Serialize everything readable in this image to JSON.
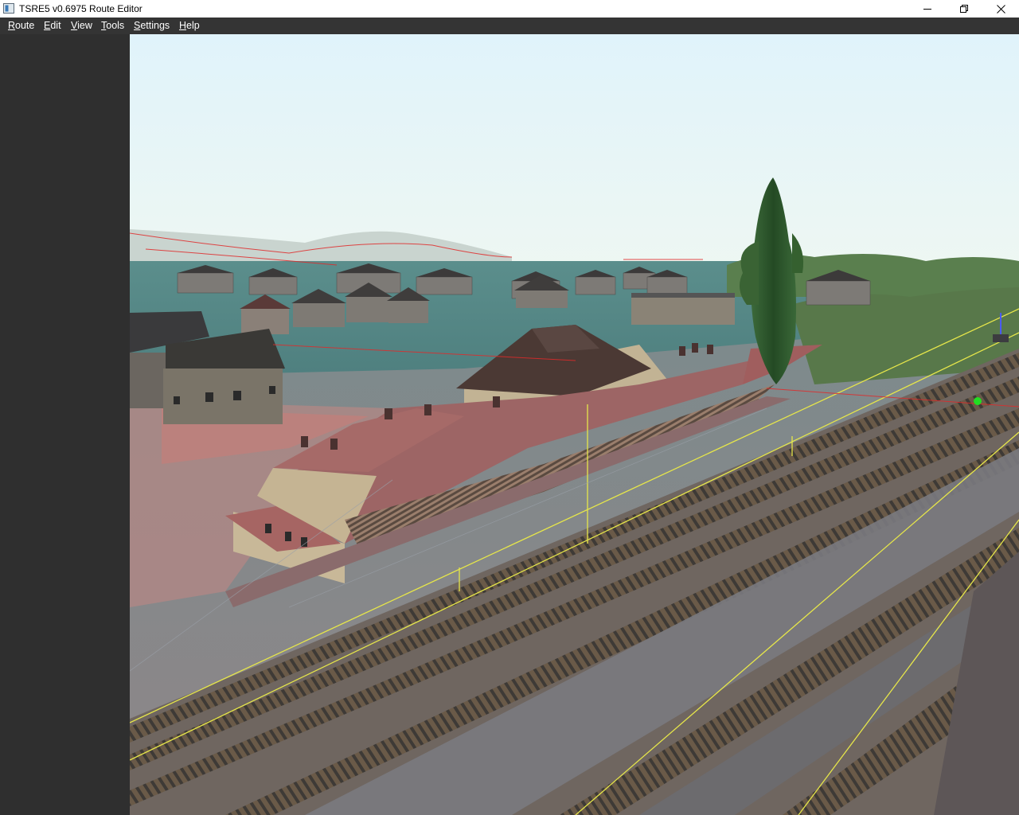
{
  "window": {
    "title": "TSRE5 v0.6975 Route Editor",
    "controls": [
      "minimize-icon",
      "restore-icon",
      "close-icon"
    ]
  },
  "menu": {
    "items": [
      {
        "label_first": "R",
        "label_rest": "oute"
      },
      {
        "label_first": "E",
        "label_rest": "dit"
      },
      {
        "label_first": "V",
        "label_rest": "iew"
      },
      {
        "label_first": "T",
        "label_rest": "ools"
      },
      {
        "label_first": "S",
        "label_rest": "ettings"
      },
      {
        "label_first": "H",
        "label_rest": "elp"
      }
    ]
  },
  "colors": {
    "titlebar_bg": "#ffffff",
    "menubar_bg": "#343434",
    "menu_text": "#ffffff",
    "sidebar_bg": "#2f2f2f",
    "sky": "#e3f3fb",
    "selection_marker": "#22dd22",
    "track_guide": "#e6e64a",
    "terrain_guide": "#e02a2a"
  },
  "viewport": {
    "scene": "3d-route-view-railway-station"
  }
}
